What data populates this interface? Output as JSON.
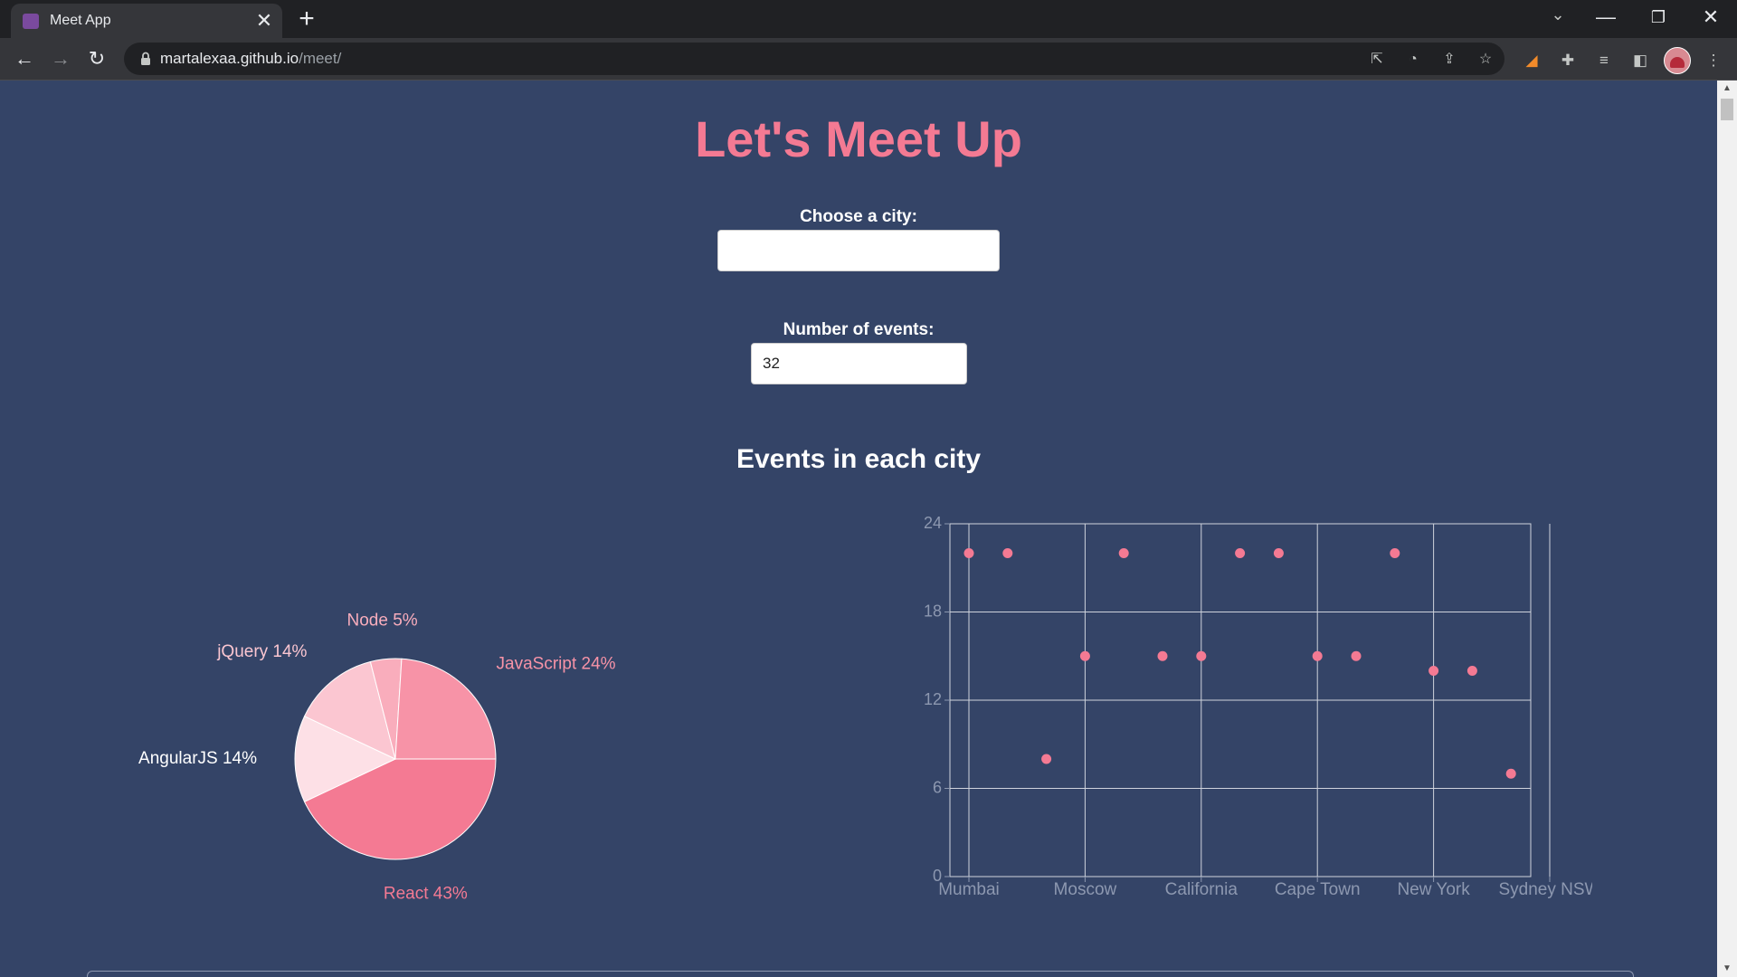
{
  "browser": {
    "tab_title": "Meet App",
    "tab_close": "✕",
    "new_tab": "+",
    "tab_search": "⌄",
    "url_host": "martalexaa.github.io",
    "url_path": "/meet/",
    "window_controls": {
      "minimize": "—",
      "restore": "❐",
      "close": "✕"
    },
    "nav": {
      "back": "←",
      "forward": "→",
      "reload": "↻"
    }
  },
  "page": {
    "title": "Let's Meet Up",
    "city_label": "Choose a city:",
    "city_value": "",
    "events_label": "Number of events:",
    "events_value": "32",
    "charts_title": "Events in each city"
  },
  "colors": {
    "page_bg": "#344467",
    "accent": "#f47a93"
  },
  "chart_data": [
    {
      "type": "pie",
      "slices": [
        {
          "label": "React",
          "percent": 43,
          "color": "#f47a93",
          "label_color": "#f47a93"
        },
        {
          "label": "AngularJS",
          "percent": 14,
          "color": "#fde0e6",
          "label_color": "#ffffff"
        },
        {
          "label": "jQuery",
          "percent": 14,
          "color": "#fbc6d1",
          "label_color": "#fbc6d1"
        },
        {
          "label": "Node",
          "percent": 5,
          "color": "#f9adbc",
          "label_color": "#f9adbc"
        },
        {
          "label": "JavaScript",
          "percent": 24,
          "color": "#f793a7",
          "label_color": "#f793a7"
        }
      ]
    },
    {
      "type": "scatter",
      "x_tick_labels": [
        "Mumbai",
        "Moscow",
        "California",
        "Cape Town",
        "New York",
        "Sydney NSW"
      ],
      "y_ticks": [
        0,
        6,
        12,
        18,
        24
      ],
      "ylim": [
        0,
        24
      ],
      "grid": true,
      "point_color": "#f47a93",
      "points": [
        {
          "x": 0,
          "y": 22
        },
        {
          "x": 1,
          "y": 22
        },
        {
          "x": 2,
          "y": 8
        },
        {
          "x": 3,
          "y": 15
        },
        {
          "x": 4,
          "y": 22
        },
        {
          "x": 5,
          "y": 15
        },
        {
          "x": 6,
          "y": 15
        },
        {
          "x": 7,
          "y": 22
        },
        {
          "x": 8,
          "y": 22
        },
        {
          "x": 9,
          "y": 15
        },
        {
          "x": 10,
          "y": 15
        },
        {
          "x": 11,
          "y": 22
        },
        {
          "x": 12,
          "y": 14
        },
        {
          "x": 13,
          "y": 14
        },
        {
          "x": 14,
          "y": 7
        }
      ]
    }
  ]
}
